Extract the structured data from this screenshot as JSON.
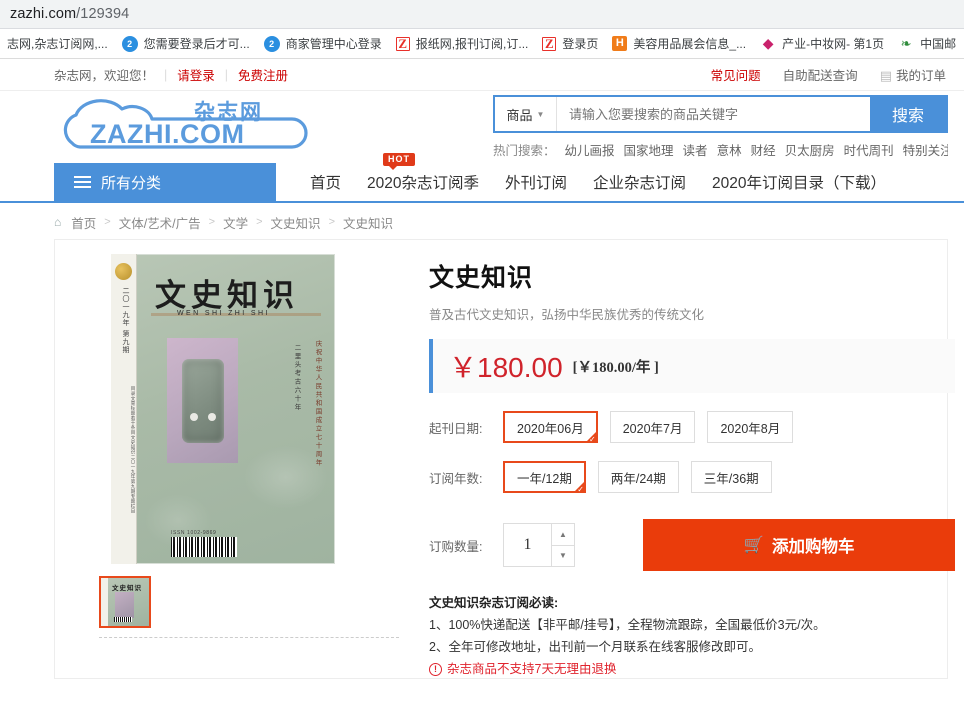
{
  "browser": {
    "url_host": "zazhi.com",
    "url_path": "/129394",
    "bookmarks": [
      {
        "icon": "",
        "icon_kind": "none",
        "label": "志网,杂志订阅网,..."
      },
      {
        "icon": "2",
        "icon_kind": "cloud",
        "label": "您需要登录后才可..."
      },
      {
        "icon": "2",
        "icon_kind": "cloud",
        "label": "商家管理中心登录"
      },
      {
        "icon": "Z",
        "icon_kind": "zletter",
        "label": "报纸网,报刊订阅,订..."
      },
      {
        "icon": "Z",
        "icon_kind": "zletter",
        "label": "登录页"
      },
      {
        "icon": "H",
        "icon_kind": "hletter",
        "label": "美容用品展会信息_..."
      },
      {
        "icon": "◆",
        "icon_kind": "diamond",
        "label": "产业-中妆网- 第1页"
      },
      {
        "icon": "❧",
        "icon_kind": "leaf",
        "label": "中国邮"
      }
    ]
  },
  "topbar": {
    "welcome": "杂志网，欢迎您！",
    "login": "请登录",
    "register": "免费注册",
    "faq": "常见问题",
    "delivery": "自助配送查询",
    "my_orders": "我的订单"
  },
  "logo": {
    "cn": "杂志网",
    "en": "ZAZHI.COM"
  },
  "search": {
    "category": "商品",
    "placeholder": "请输入您要搜索的商品关键字",
    "value": "",
    "button": "搜索",
    "hot_label": "热门搜索：",
    "hot_terms": [
      "幼儿画报",
      "国家地理",
      "读者",
      "意林",
      "财经",
      "贝太厨房",
      "时代周刊",
      "特别关注"
    ]
  },
  "nav": {
    "all_categories": "所有分类",
    "badge": "HOT",
    "links": [
      "首页",
      "2020杂志订阅季",
      "外刊订阅",
      "企业杂志订阅",
      "2020年订阅目录（下载）"
    ]
  },
  "breadcrumb": [
    "首页",
    "文体/艺术/广告",
    "文学",
    "文史知识",
    "文史知识"
  ],
  "product": {
    "title": "文史知识",
    "subtitle": "普及古代文史知识，弘扬中华民族优秀的传统文化",
    "price": "￥180.00",
    "price_unit": "[￥180.00/年 ]",
    "start_date_label": "起刊日期:",
    "start_date_options": [
      "2020年06月",
      "2020年7月",
      "2020年8月"
    ],
    "start_date_selected": "2020年06月",
    "years_label": "订阅年数:",
    "years_options": [
      "一年/12期",
      "两年/24期",
      "三年/36期"
    ],
    "years_selected": "一年/12期",
    "qty_label": "订购数量:",
    "qty_value": "1",
    "cart_button": "添加购物车",
    "notes_heading": "文史知识杂志订阅必读:",
    "note1": "1、100%快递配送【非平邮/挂号】，全程物流跟踪，全国最低价3元/次。",
    "note2": "2、全年可修改地址，出刊前一个月联系在线客服修改即可。",
    "warning": "杂志商品不支持7天无理由退换"
  },
  "cover": {
    "title": "文史知识",
    "pinyin": "WEN SHI ZHI SHI",
    "spine_year": "二〇一九年  第九期",
    "side_text": "庆祝中华人民共和国成立七十周年",
    "side_text2": "二里头考古六十年",
    "issn": "ISSN 1002-9869"
  },
  "colors": {
    "brand_blue": "#4a90d9",
    "accent_red": "#c00",
    "price_red": "#d0232b",
    "cart_orange": "#ea3c0b",
    "select_orange": "#e8491b"
  }
}
